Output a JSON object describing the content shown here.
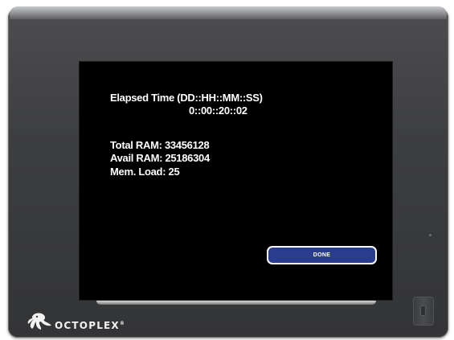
{
  "device": {
    "brand": "OctoPlex",
    "brand_display": "OCTOPLEX",
    "trademark": "®"
  },
  "screen": {
    "elapsed_label": "Elapsed Time (DD::HH::MM::SS)",
    "elapsed_value": "0::00::20::02",
    "total_ram_label": "Total RAM: 33456128",
    "avail_ram_label": "Avail RAM: 25186304",
    "mem_load_label": "Mem. Load: 25",
    "done_button_label": "DONE"
  },
  "colors": {
    "screen_background": "#000000",
    "button_fill": "#2a3c8e",
    "button_border": "#ffffff",
    "frame": "#3d3e40",
    "text": "#ffffff"
  },
  "icons": {
    "logo_mark": "octopus-icon",
    "side_button": "hardware-button-icon"
  }
}
